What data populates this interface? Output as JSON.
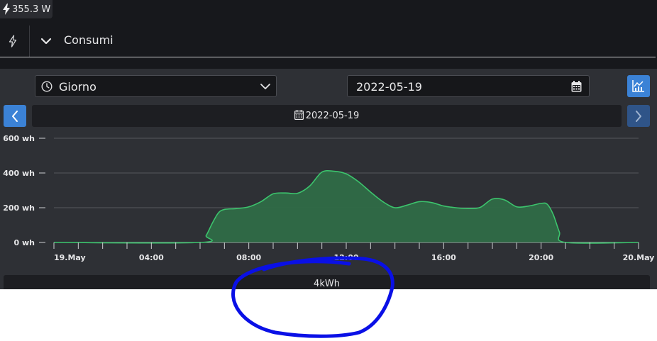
{
  "status": {
    "power": "355.3 W"
  },
  "header": {
    "title": "Consumi"
  },
  "controls": {
    "period_select": {
      "selected": "Giorno"
    },
    "date_input": {
      "value": "2022-05-19"
    },
    "date_label": "2022-05-19"
  },
  "total": {
    "value": "4kWh"
  },
  "colors": {
    "accent": "#3b82d6",
    "series": "#3cc46d",
    "series_fill": "#2f6b47"
  },
  "icons": {
    "power": "bolt-icon",
    "clock": "clock-icon",
    "calendar": "calendar-icon",
    "chart": "chart-icon"
  },
  "chart_data": {
    "type": "area",
    "xlabel": "",
    "ylabel": "",
    "y_ticks": [
      "0 wh",
      "200 wh",
      "400 wh",
      "600 wh"
    ],
    "x_ticks": [
      "19.May",
      "04:00",
      "08:00",
      "12:00",
      "16:00",
      "20:00",
      "20.May"
    ],
    "ylim": [
      0,
      600
    ],
    "xlim": [
      0,
      24
    ],
    "grid": true,
    "x": [
      0,
      6,
      6.25,
      6.5,
      6.75,
      7,
      7.5,
      8,
      8.5,
      9,
      9.5,
      10,
      10.5,
      11,
      11.5,
      12,
      12.5,
      13,
      13.5,
      14,
      14.5,
      15,
      15.5,
      16,
      16.5,
      17,
      17.5,
      18,
      18.5,
      19,
      19.5,
      20,
      20.25,
      20.5,
      20.75,
      21,
      24
    ],
    "values": [
      0,
      0,
      40,
      110,
      170,
      190,
      195,
      205,
      235,
      280,
      285,
      283,
      325,
      405,
      410,
      395,
      350,
      290,
      235,
      200,
      215,
      235,
      230,
      210,
      200,
      195,
      202,
      250,
      245,
      205,
      210,
      225,
      220,
      160,
      60,
      0,
      0
    ]
  }
}
